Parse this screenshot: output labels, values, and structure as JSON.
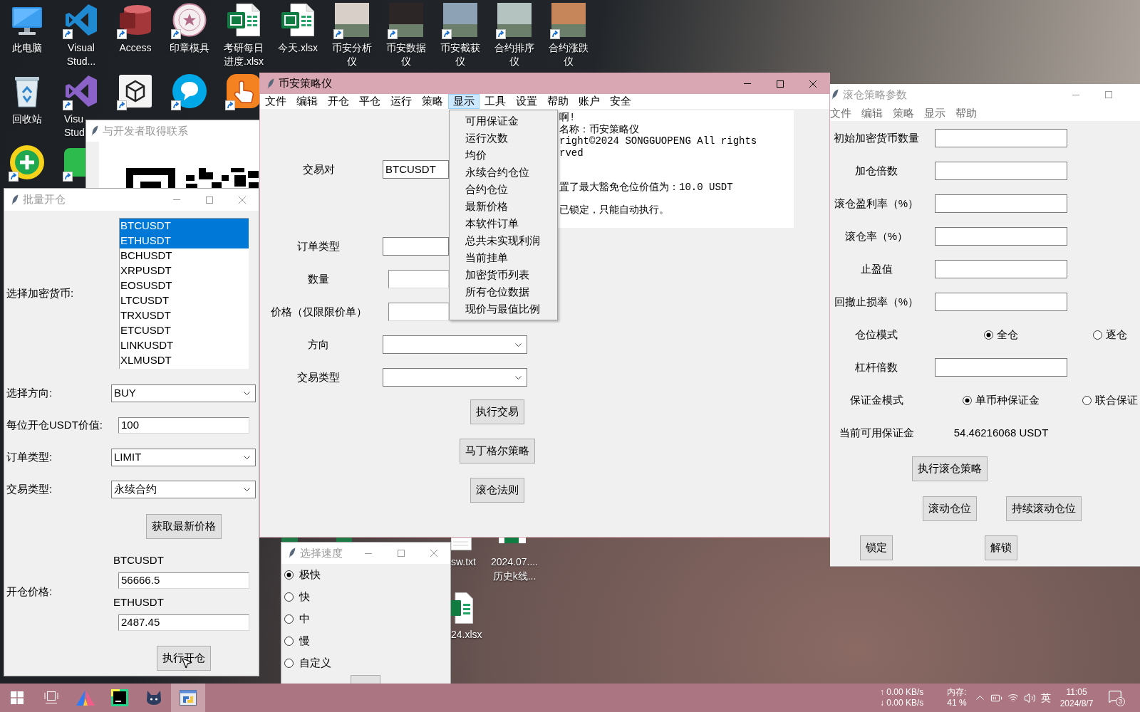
{
  "desktop": {
    "icon_rows": [
      [
        {
          "kind": "computer",
          "label": "此电脑",
          "shortcut": false
        },
        {
          "kind": "ribbon_blue",
          "label": "Visual Stud...",
          "shortcut": true
        },
        {
          "kind": "database",
          "label": "Access",
          "shortcut": true
        },
        {
          "kind": "stamp",
          "label": "印章模具",
          "shortcut": true
        },
        {
          "kind": "spreadsheet",
          "label": "考研每日进度.xlsx",
          "shortcut": false
        },
        {
          "kind": "spreadsheet",
          "label": "今天.xlsx",
          "shortcut": false
        },
        {
          "kind": "photo",
          "label": "币安分析仪",
          "shortcut": true
        },
        {
          "kind": "photo",
          "label": "币安数据仪",
          "shortcut": true
        },
        {
          "kind": "photo",
          "label": "币安截获仪",
          "shortcut": true
        },
        {
          "kind": "photo",
          "label": "合约排序仪",
          "shortcut": true
        },
        {
          "kind": "photo",
          "label": "合约涨跌仪",
          "shortcut": true
        }
      ],
      [
        {
          "kind": "recycle_bin",
          "label": "回收站",
          "shortcut": false
        },
        {
          "kind": "ribbon_purple",
          "label": "Visu Stud",
          "shortcut": true,
          "truncated": true
        },
        {
          "kind": "cube",
          "shortcut": true
        },
        {
          "kind": "chat_bubble",
          "shortcut": true
        },
        {
          "kind": "pointing_hand",
          "shortcut": true
        }
      ],
      [
        {
          "kind": "plus_circle",
          "shortcut": true
        },
        {
          "kind": "partial_tile",
          "shortcut": true
        }
      ]
    ],
    "lower_items": [
      {
        "kind": "document_top",
        "label_lines": [
          "sw.txt"
        ]
      },
      {
        "kind": "spreadsheet_top",
        "label_lines": [
          "2024.07....",
          "历史k线..."
        ]
      },
      {
        "kind": "spreadsheet_partial",
        "label_lines": [
          "24.xlsx"
        ]
      }
    ]
  },
  "contact_window": {
    "title": "与开发者取得联系",
    "active": false
  },
  "batch_window": {
    "title": "批量开仓",
    "active": false,
    "coin_label": "选择加密货币:",
    "coins": [
      {
        "label": "BTCUSDT",
        "selected": true
      },
      {
        "label": "ETHUSDT",
        "selected": true
      },
      {
        "label": "BCHUSDT",
        "selected": false
      },
      {
        "label": "XRPUSDT",
        "selected": false
      },
      {
        "label": "EOSUSDT",
        "selected": false
      },
      {
        "label": "LTCUSDT",
        "selected": false
      },
      {
        "label": "TRXUSDT",
        "selected": false
      },
      {
        "label": "ETCUSDT",
        "selected": false
      },
      {
        "label": "LINKUSDT",
        "selected": false
      },
      {
        "label": "XLMUSDT",
        "selected": false
      }
    ],
    "fields": [
      {
        "kind": "combo",
        "label": "选择方向:",
        "value": "BUY"
      },
      {
        "kind": "entry",
        "label": "每位开仓USDT价值:",
        "value": "100"
      },
      {
        "kind": "combo",
        "label": "订单类型:",
        "value": "LIMIT"
      },
      {
        "kind": "combo",
        "label": "交易类型:",
        "value": "永续合约"
      }
    ],
    "fetch_button": "获取最新价格",
    "price_label": "开仓价格:",
    "prices": [
      {
        "symbol": "BTCUSDT",
        "value": "56666.5"
      },
      {
        "symbol": "ETHUSDT",
        "value": "2487.45"
      }
    ],
    "submit_button": "执行开仓"
  },
  "main_window": {
    "title": "币安策略仪",
    "active": true,
    "menu": [
      {
        "label": "文件",
        "selected": false
      },
      {
        "label": "编辑",
        "selected": false
      },
      {
        "label": "开仓",
        "selected": false
      },
      {
        "label": "平仓",
        "selected": false
      },
      {
        "label": "运行",
        "selected": false
      },
      {
        "label": "策略",
        "selected": false
      },
      {
        "label": "显示",
        "selected": true,
        "items": [
          "可用保证金",
          "运行次数",
          "均价",
          "永续合约仓位",
          "合约仓位",
          "最新价格",
          "本软件订单",
          "总共未实现利润",
          "当前挂单",
          "加密货币列表",
          "所有仓位数据",
          "现价与最值比例"
        ]
      },
      {
        "label": "工具",
        "selected": false
      },
      {
        "label": "设置",
        "selected": false
      },
      {
        "label": "帮助",
        "selected": false
      },
      {
        "label": "账户",
        "selected": false
      },
      {
        "label": "安全",
        "selected": false
      }
    ],
    "log": [
      [
        "啊!",
        "名称：币安策略仪",
        "right©2024 SONGGUOPENG All rights",
        "rved"
      ],
      [
        "置了最大豁免仓位价值为：10.0 USDT"
      ],
      [
        "已锁定，只能自动执行。"
      ]
    ],
    "form_groups": [
      [
        {
          "kind": "combo",
          "label": "交易对",
          "value": "BTCUSDT"
        }
      ],
      [
        {
          "kind": "combo",
          "label": "订单类型"
        },
        {
          "kind": "entry",
          "label": "数量"
        },
        {
          "kind": "entry",
          "label": "价格（仅限限价单）"
        },
        {
          "kind": "combo",
          "label": "方向"
        },
        {
          "kind": "combo",
          "label": "交易类型"
        }
      ]
    ],
    "buttons": [
      "执行交易",
      "马丁格尔策略",
      "滚仓法则"
    ]
  },
  "rolling_window": {
    "title": "滚仓策略参数",
    "active": false,
    "menu": [
      "文件",
      "编辑",
      "策略",
      "显示",
      "帮助"
    ],
    "rows": [
      {
        "kind": "entry",
        "label": "初始加密货币数量"
      },
      {
        "kind": "entry",
        "label": "加仓倍数"
      },
      {
        "kind": "entry",
        "label": "滚仓盈利率（%）"
      },
      {
        "kind": "entry",
        "label": "滚仓率（%）"
      },
      {
        "kind": "entry",
        "label": "止盈值"
      },
      {
        "kind": "entry",
        "label": "回撤止损率（%）"
      },
      {
        "kind": "radio",
        "label": "仓位模式",
        "options": [
          {
            "label": "全仓",
            "selected": true
          },
          {
            "label": "逐仓",
            "selected": false
          }
        ]
      },
      {
        "kind": "entry",
        "label": "杠杆倍数"
      },
      {
        "kind": "radio",
        "label": "保证金模式",
        "options": [
          {
            "label": "单币种保证金",
            "selected": true
          },
          {
            "label": "联合保证",
            "selected": false
          }
        ]
      },
      {
        "kind": "text",
        "label": "当前可用保证金",
        "value": "54.46216068 USDT"
      }
    ],
    "button_rows": [
      [
        "执行滚仓策略"
      ],
      [
        "滚动仓位",
        "持续滚动仓位"
      ],
      [
        "锁定",
        "解锁"
      ]
    ]
  },
  "speed_window": {
    "title": "选择速度",
    "active": false,
    "options": [
      {
        "label": "极快",
        "selected": true
      },
      {
        "label": "快",
        "selected": false
      },
      {
        "label": "中",
        "selected": false
      },
      {
        "label": "慢",
        "selected": false
      },
      {
        "label": "自定义",
        "selected": false
      }
    ]
  },
  "taskbar": {
    "buttons": [
      {
        "kind": "start",
        "active": false
      },
      {
        "kind": "task_view",
        "active": false
      },
      {
        "kind": "triangle_app",
        "active": false
      },
      {
        "kind": "square_tile",
        "active": false
      },
      {
        "kind": "cat",
        "active": false
      },
      {
        "kind": "app_window",
        "active": true
      }
    ],
    "network_up": "↑ 0.00 KB/s",
    "network_down": "↓ 0.00 KB/s",
    "memory_label": "内存:",
    "memory_value": "41 %",
    "input_method": "英",
    "time": "11:05",
    "date": "2024/8/7",
    "notifications": "3"
  }
}
